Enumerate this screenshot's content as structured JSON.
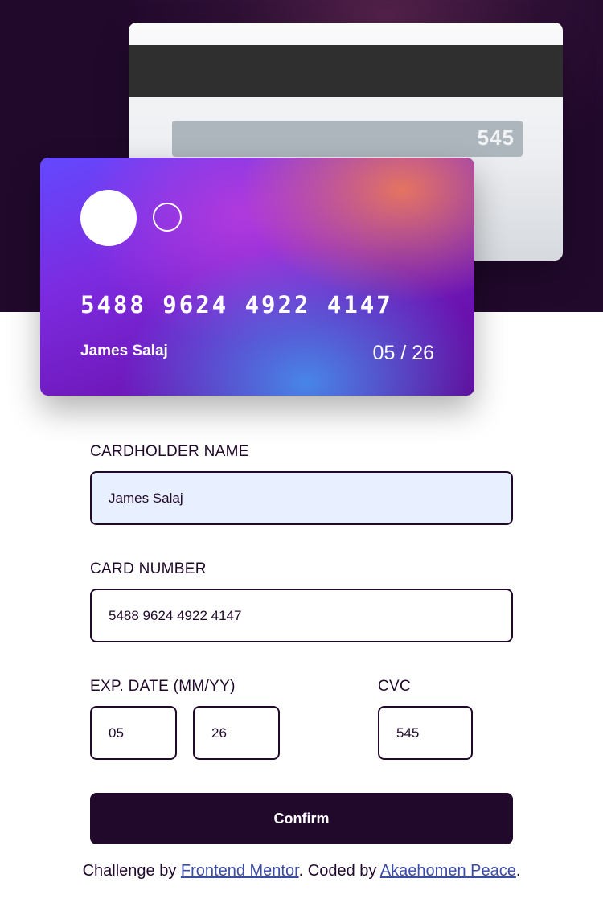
{
  "card_back": {
    "cvc": "545"
  },
  "card_front": {
    "number": "5488 9624 4922 4147",
    "holder_name": "James Salaj",
    "expiry": "05 / 26"
  },
  "form": {
    "cardholder_label": "CARDHOLDER NAME",
    "cardholder_value": "James Salaj",
    "card_number_label": "CARD NUMBER",
    "card_number_value": "5488 9624 4922 4147",
    "exp_label": "EXP. DATE (MM/YY)",
    "exp_month_value": "05",
    "exp_year_value": "26",
    "cvc_label": "CVC",
    "cvc_value": "545",
    "confirm_label": "Confirm"
  },
  "footer": {
    "prefix": "Challenge by ",
    "link1": "Frontend Mentor",
    "middle": ". Coded by ",
    "link2": "Akaehomen Peace",
    "suffix": "."
  },
  "colors": {
    "dark_violet": "#21092c",
    "field_autofill_bg": "#e8effe",
    "link": "#3b4ba8"
  }
}
